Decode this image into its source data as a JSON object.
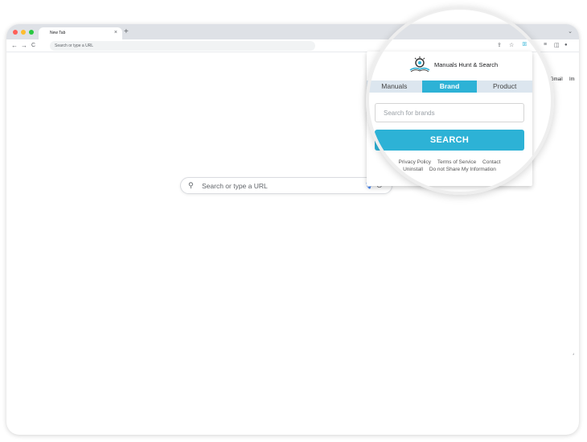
{
  "browser": {
    "tab_title": "New Tab",
    "tab_close": "×",
    "new_tab": "+",
    "tab_list": "⌄",
    "back": "←",
    "forward": "→",
    "reload": "C",
    "omnibox_placeholder": "Search or type a URL",
    "traffic_colors": [
      "#ff5f57",
      "#febc2e",
      "#28c840"
    ]
  },
  "toolbar_icons": {
    "share": "⇪",
    "star": "☆",
    "extension_badge": "ꕥ",
    "media": "≡",
    "sidepanel": "◫",
    "profile": "●"
  },
  "ntp": {
    "link_gmail": "Gmail",
    "link_images": "Im",
    "search_placeholder": "Search or type a URL",
    "search_icon": "⚲",
    "mic_icon": "🎙",
    "lens_icon": "⊙"
  },
  "popup": {
    "brand_name": "Manuals Hunt & Search",
    "tabs": [
      {
        "label": "Manuals",
        "active": false
      },
      {
        "label": "Brand",
        "active": true
      },
      {
        "label": "Product",
        "active": false
      }
    ],
    "search_placeholder": "Search for brands",
    "search_button": "SEARCH",
    "footer_row1": [
      "Privacy Policy",
      "Terms of Service",
      "Contact"
    ],
    "footer_row2": [
      "Uninstall",
      "Do not Share My Information"
    ],
    "accent_color": "#2db2d6"
  }
}
